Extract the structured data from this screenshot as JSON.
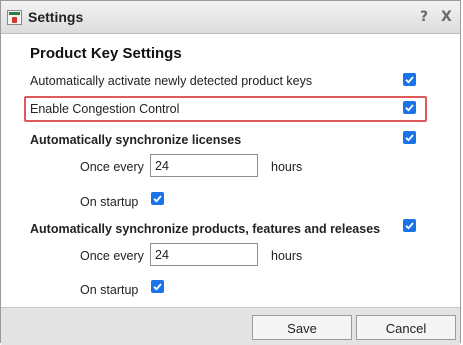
{
  "window": {
    "title": "Settings",
    "help_glyph": "?",
    "close_glyph": "X"
  },
  "heading": "Product Key Settings",
  "settings": {
    "auto_activate": {
      "label": "Automatically activate newly detected product keys",
      "checked": true
    },
    "congestion": {
      "label": "Enable Congestion Control",
      "checked": true
    },
    "sync_licenses": {
      "label": "Automatically synchronize licenses",
      "checked": true,
      "interval_label": "Once every",
      "interval_value": "24",
      "unit": "hours",
      "startup_label": "On startup",
      "startup_checked": true
    },
    "sync_products": {
      "label": "Automatically synchronize products, features and releases",
      "checked": true,
      "interval_label": "Once every",
      "interval_value": "24",
      "unit": "hours",
      "startup_label": "On startup",
      "startup_checked": true
    }
  },
  "footer": {
    "save_label": "Save",
    "cancel_label": "Cancel"
  },
  "colors": {
    "checkbox": "#1a73e8",
    "highlight": "#e05a5a",
    "footer": "#e3e3e3"
  },
  "icons": {
    "app": "settings-app-icon",
    "check": "check-icon"
  }
}
